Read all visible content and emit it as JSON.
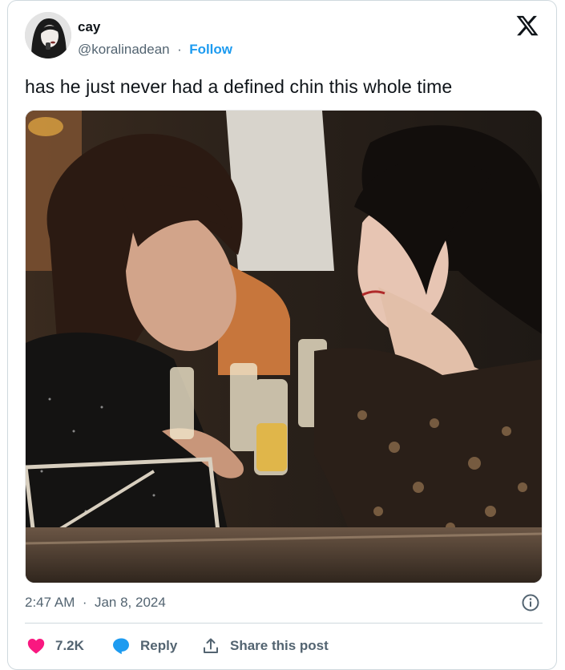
{
  "author": {
    "display_name": "cay",
    "handle": "@koralinadean",
    "separator": "·",
    "follow_label": "Follow"
  },
  "tweet": {
    "text": "has he just never had a defined chin this whole time",
    "time": "2:47 AM",
    "separator": "·",
    "date": "Jan 8, 2024"
  },
  "actions": {
    "likes": "7.2K",
    "reply_label": "Reply",
    "share_label": "Share this post"
  },
  "icons": {
    "logo": "x-logo-icon",
    "info": "info-icon",
    "like": "heart-icon",
    "reply": "speech-bubble-icon",
    "share": "upload-arrow-icon"
  },
  "colors": {
    "accent": "#1d9bf0",
    "like": "#f91880",
    "text": "#0f1419",
    "secondary": "#536471",
    "border": "#cfd9de"
  }
}
